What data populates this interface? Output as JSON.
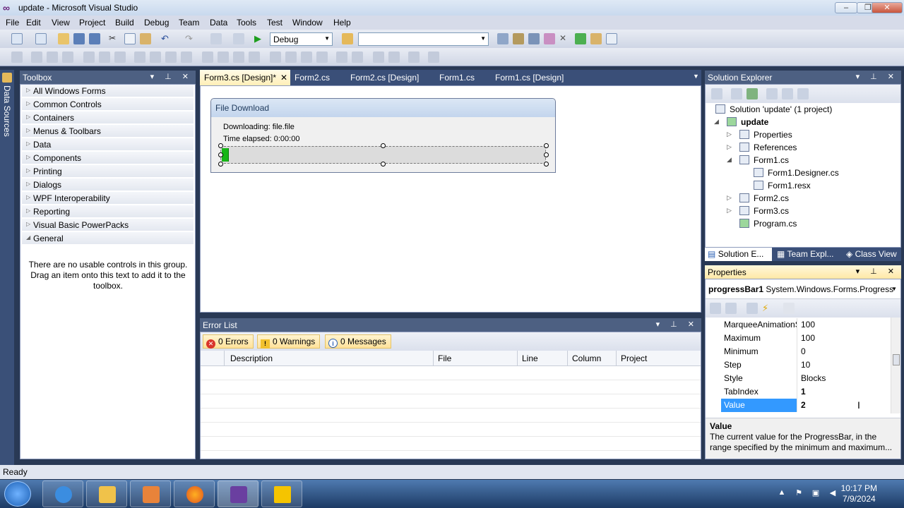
{
  "window": {
    "title": "update - Microsoft Visual Studio",
    "controls": [
      "–",
      "❐",
      "✕"
    ]
  },
  "menu": [
    "File",
    "Edit",
    "View",
    "Project",
    "Build",
    "Debug",
    "Team",
    "Data",
    "Tools",
    "Test",
    "Window",
    "Help"
  ],
  "toolbar": {
    "config": "Debug",
    "platform": ""
  },
  "left_strip": {
    "label": "Data Sources"
  },
  "toolbox": {
    "title": "Toolbox",
    "groups": [
      "All Windows Forms",
      "Common Controls",
      "Containers",
      "Menus & Toolbars",
      "Data",
      "Components",
      "Printing",
      "Dialogs",
      "WPF Interoperability",
      "Reporting",
      "Visual Basic PowerPacks",
      "General"
    ],
    "empty_message": "There are no usable controls in this group. Drag an item onto this text to add it to the toolbox."
  },
  "doc_tabs": [
    "Form3.cs [Design]*",
    "Form2.cs",
    "Form2.cs [Design]",
    "Form1.cs",
    "Form1.cs [Design]"
  ],
  "form3": {
    "caption": "File Download",
    "downloading": "Downloading: file.file",
    "elapsed": "Time elapsed: 0:00:00",
    "progress_value": 2,
    "progress_max": 100
  },
  "error_list": {
    "title": "Error List",
    "errors": "0 Errors",
    "warnings": "0 Warnings",
    "messages": "0 Messages",
    "columns": [
      "Description",
      "File",
      "Line",
      "Column",
      "Project"
    ]
  },
  "solution_explorer": {
    "title": "Solution Explorer",
    "solution": "Solution 'update' (1 project)",
    "project": "update",
    "items": [
      "Properties",
      "References",
      "Form1.cs",
      "Form1.Designer.cs",
      "Form1.resx",
      "Form2.cs",
      "Form3.cs",
      "Program.cs"
    ],
    "tabs": [
      "Solution E...",
      "Team Expl...",
      "Class View"
    ]
  },
  "properties": {
    "title": "Properties",
    "object": "progressBar1",
    "type": "System.Windows.Forms.Progress",
    "rows": [
      {
        "name": "MarqueeAnimationSpeed",
        "value": "100"
      },
      {
        "name": "Maximum",
        "value": "100"
      },
      {
        "name": "Minimum",
        "value": "0"
      },
      {
        "name": "Step",
        "value": "10"
      },
      {
        "name": "Style",
        "value": "Blocks"
      },
      {
        "name": "TabIndex",
        "value": "1"
      },
      {
        "name": "Value",
        "value": "2"
      }
    ],
    "desc_title": "Value",
    "desc_text": "The current value for the ProgressBar, in the range specified by the minimum and maximum..."
  },
  "status": "Ready",
  "clock": {
    "time": "10:17 PM",
    "date": "7/9/2024"
  },
  "colors": {
    "accent": "#4d6082",
    "progress": "#17b617",
    "selection": "#3399ff"
  }
}
